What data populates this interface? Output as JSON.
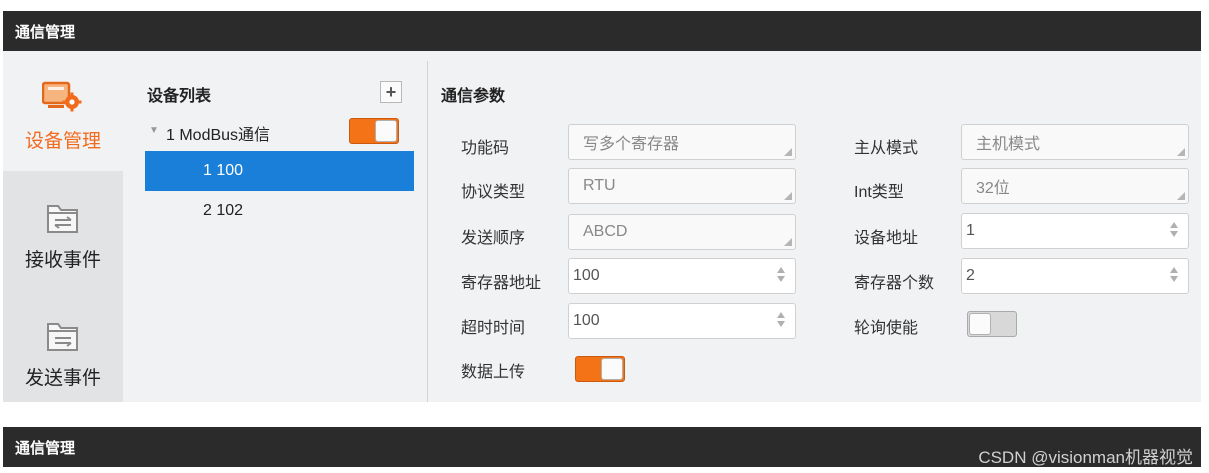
{
  "window": {
    "title": "通信管理"
  },
  "watermark": "CSDN @visionman机器视觉",
  "nav": [
    {
      "label": "设备管理",
      "icon": "device-gear-icon",
      "active": true
    },
    {
      "label": "接收事件",
      "icon": "folder-receive-icon",
      "active": false
    },
    {
      "label": "发送事件",
      "icon": "folder-send-icon",
      "active": false
    }
  ],
  "device_list": {
    "title": "设备列表",
    "add_icon": "plus-icon",
    "group": {
      "label": "1 ModBus通信",
      "enabled": true
    },
    "items": [
      {
        "label": "1 100",
        "selected": true
      },
      {
        "label": "2 102",
        "selected": false
      }
    ]
  },
  "params": {
    "title": "通信参数",
    "function_code": {
      "label": "功能码",
      "value": "写多个寄存器"
    },
    "protocol_type": {
      "label": "协议类型",
      "value": "RTU"
    },
    "send_order": {
      "label": "发送顺序",
      "value": "ABCD"
    },
    "register_address": {
      "label": "寄存器地址",
      "value": "100"
    },
    "timeout": {
      "label": "超时时间",
      "value": "100"
    },
    "data_upload": {
      "label": "数据上传",
      "enabled": true
    },
    "master_slave": {
      "label": "主从模式",
      "value": "主机模式"
    },
    "int_type": {
      "label": "Int类型",
      "value": "32位"
    },
    "device_address": {
      "label": "设备地址",
      "value": "1"
    },
    "register_count": {
      "label": "寄存器个数",
      "value": "2"
    },
    "polling_enable": {
      "label": "轮询使能",
      "enabled": false
    }
  },
  "colors": {
    "accent": "#f26b1d",
    "selection": "#1a7fd9",
    "titlebar": "#2b2b2b"
  },
  "bottom_window": {
    "title": "通信管理"
  }
}
